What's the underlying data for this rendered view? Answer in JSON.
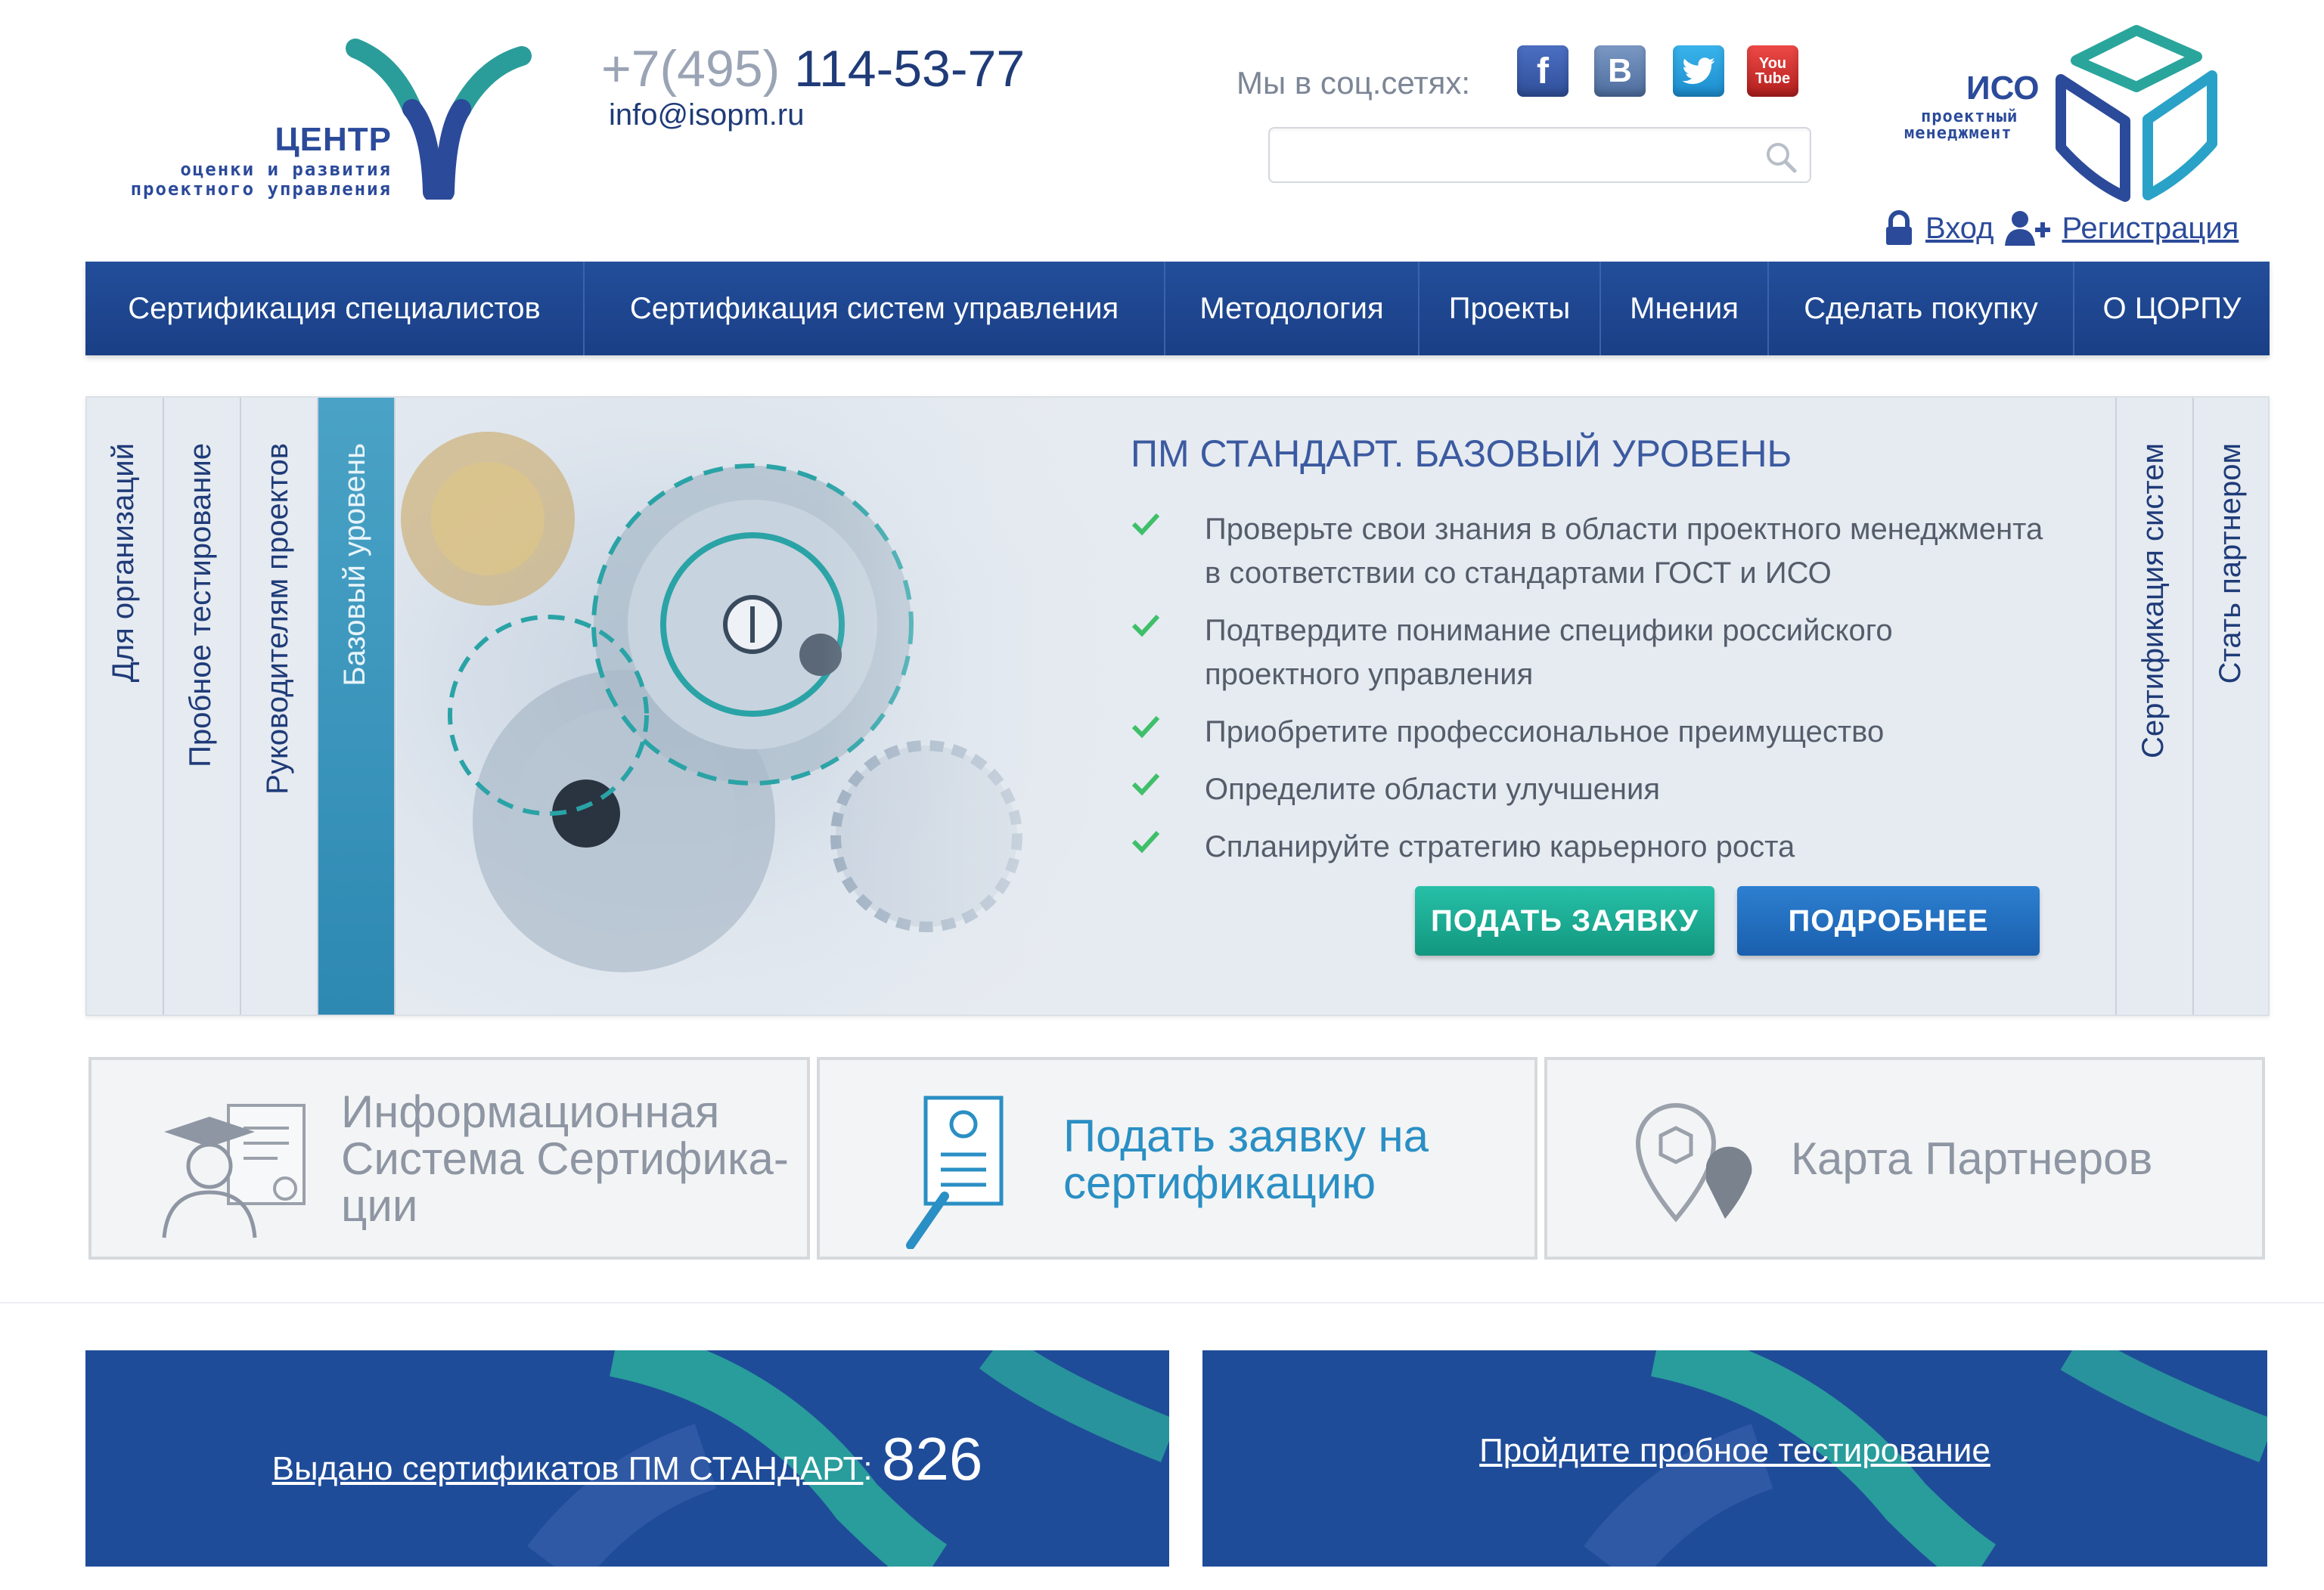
{
  "header": {
    "logo": {
      "title": "ЦЕНТР",
      "line1": "оценки и развития",
      "line2": "проектного управления"
    },
    "phone": {
      "code": "+7(495)",
      "number": "114-53-77"
    },
    "email": "info@isopm.ru",
    "social_label": "Мы в соц.сетях:",
    "social": [
      {
        "name": "facebook-icon",
        "glyph": "f"
      },
      {
        "name": "vk-icon",
        "glyph": "B"
      },
      {
        "name": "twitter-icon",
        "glyph": "t"
      },
      {
        "name": "youtube-icon",
        "glyph_top": "You",
        "glyph_bottom": "Tube"
      }
    ],
    "search": {
      "placeholder": ""
    },
    "iso_logo": {
      "title": "ИСО",
      "line1": "проектный",
      "line2": "менеджмент"
    },
    "auth": {
      "login": "Вход",
      "register": "Регистрация"
    }
  },
  "nav": [
    {
      "label": "Сертификация специалистов"
    },
    {
      "label": "Сертификация систем управления"
    },
    {
      "label": "Методология"
    },
    {
      "label": "Проекты"
    },
    {
      "label": "Мнения"
    },
    {
      "label": "Сделать покупку"
    },
    {
      "label": "О ЦОРПУ"
    }
  ],
  "slider": {
    "left_tabs": [
      {
        "label": "Для организаций"
      },
      {
        "label": "Пробное тестирование"
      },
      {
        "label": "Руководителям проектов"
      },
      {
        "label": "Базовый уровень"
      }
    ],
    "right_tabs": [
      {
        "label": "Сертификация систем"
      },
      {
        "label": "Стать партнером"
      }
    ],
    "title": "ПМ СТАНДАРТ. БАЗОВЫЙ УРОВЕНЬ",
    "bullets": [
      {
        "line1": "Проверьте свои знания в области проектного менеджмента",
        "line2": "в соответствии со стандартами ГОСТ и ИСО"
      },
      {
        "line1": "Подтвердите понимание специфики российского",
        "line2": "проектного управления"
      },
      {
        "line1": "Приобретите профессиональное преимущество",
        "line2": ""
      },
      {
        "line1": "Определите области улучшения",
        "line2": ""
      },
      {
        "line1": "Спланируйте стратегию карьерного роста",
        "line2": ""
      }
    ],
    "apply_button": "ПОДАТЬ ЗАЯВКУ",
    "more_button": "ПОДРОБНЕЕ"
  },
  "tiles": [
    {
      "line1": "Информационная",
      "line2": "Система Сертифика-",
      "line3": "ции"
    },
    {
      "line1": "Подать заявку на",
      "line2": "сертификацию"
    },
    {
      "line1": "Карта Партнеров"
    }
  ],
  "banners": {
    "certificates": {
      "label": "Выдано сертификатов ПМ СТАНДАРТ",
      "sep": ": ",
      "count": "826"
    },
    "test": {
      "label": "Пройдите пробное тестирование"
    }
  },
  "colors": {
    "nav_bg": "#1f4c99",
    "accent_teal": "#12977f",
    "accent_blue": "#1a5fae",
    "check_green": "#3fbf6a",
    "banner_bg": "#1f4c99"
  }
}
